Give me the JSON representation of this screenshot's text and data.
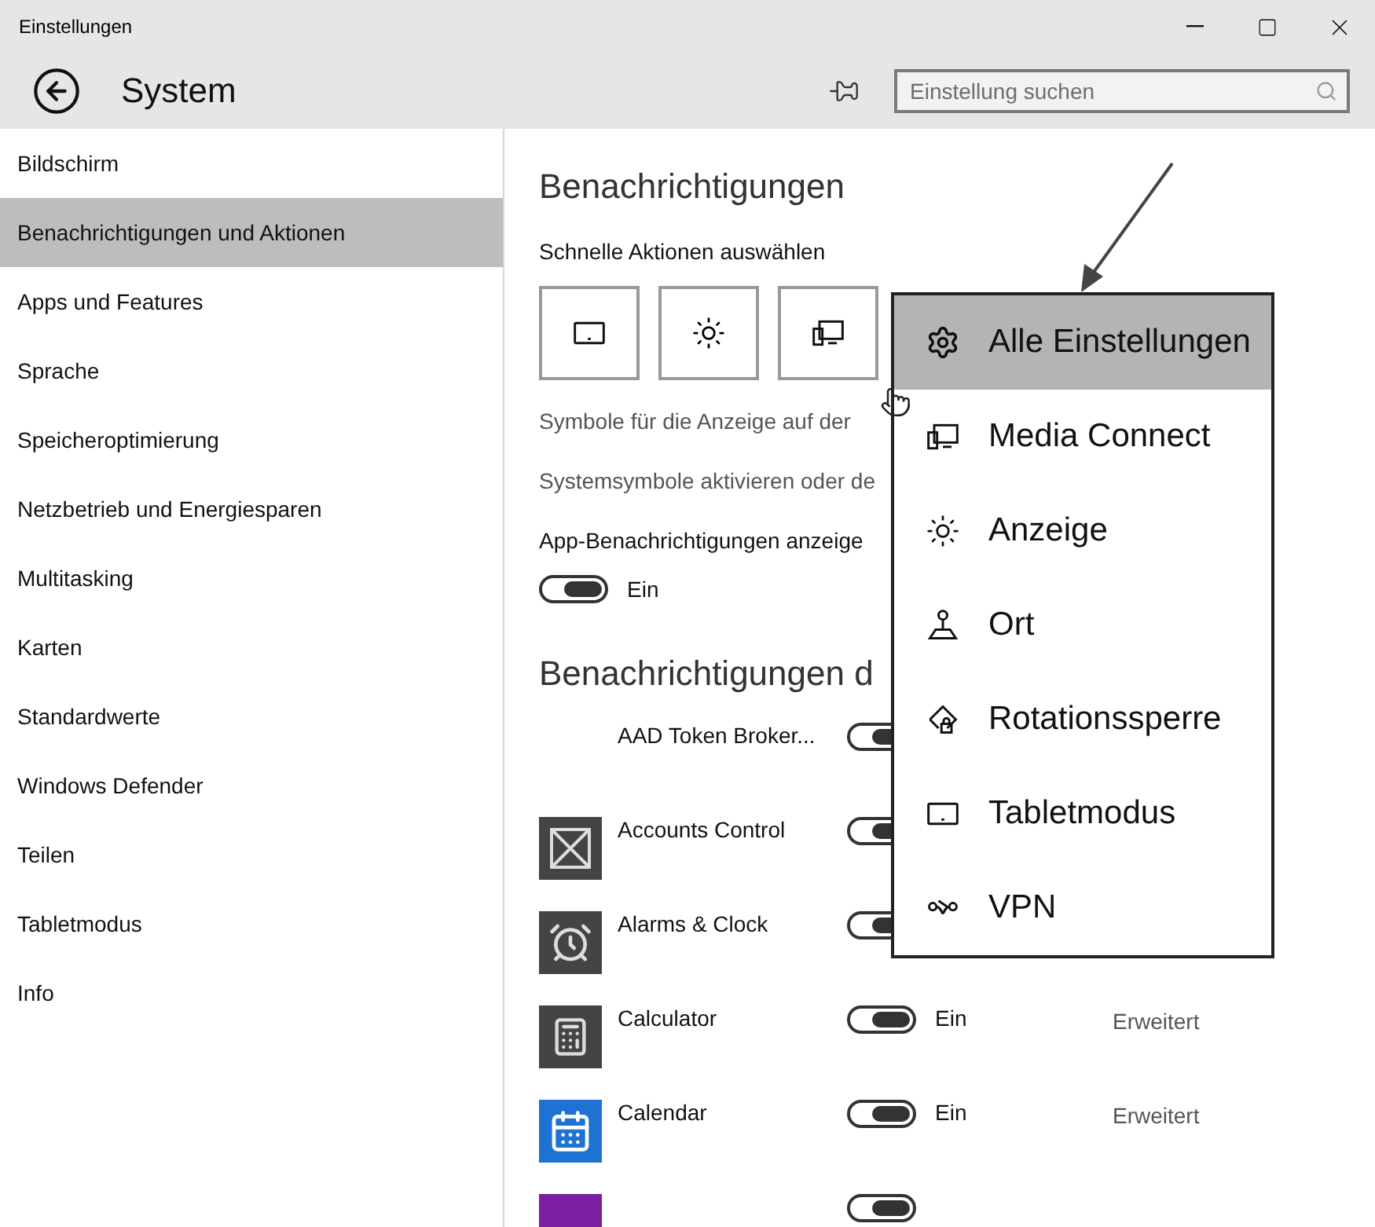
{
  "window": {
    "title": "Einstellungen"
  },
  "header": {
    "title": "System",
    "search": {
      "placeholder": "Einstellung suchen"
    }
  },
  "sidebar": {
    "items": [
      {
        "label": "Bildschirm",
        "selected": false
      },
      {
        "label": "Benachrichtigungen und Aktionen",
        "selected": true
      },
      {
        "label": "Apps und Features",
        "selected": false
      },
      {
        "label": "Sprache",
        "selected": false
      },
      {
        "label": "Speicheroptimierung",
        "selected": false
      },
      {
        "label": "Netzbetrieb und Energiesparen",
        "selected": false
      },
      {
        "label": "Multitasking",
        "selected": false
      },
      {
        "label": "Karten",
        "selected": false
      },
      {
        "label": "Standardwerte",
        "selected": false
      },
      {
        "label": "Windows Defender",
        "selected": false
      },
      {
        "label": "Teilen",
        "selected": false
      },
      {
        "label": "Tabletmodus",
        "selected": false
      },
      {
        "label": "Info",
        "selected": false
      }
    ]
  },
  "content": {
    "heading": "Benachrichtigungen",
    "quick_actions": {
      "label": "Schnelle Aktionen auswählen",
      "tiles": [
        {
          "kind": "tablet"
        },
        {
          "kind": "brightness"
        },
        {
          "kind": "connect"
        }
      ]
    },
    "link_1": "Symbole für die Anzeige auf der",
    "link_2": "Systemsymbole aktivieren oder de",
    "app_notifications": {
      "label": "App-Benachrichtigungen anzeige",
      "on": true,
      "state_label": "Ein"
    },
    "apps_heading": "Benachrichtigungen d",
    "apps": [
      {
        "name": "AAD Token Broker...",
        "on": true
      },
      {
        "name": "Accounts Control",
        "kind": "cross",
        "color": "#444444",
        "on": true
      },
      {
        "name": "Alarms & Clock",
        "kind": "alarm",
        "color": "#444444",
        "on": true
      },
      {
        "name": "Calculator",
        "kind": "calculator",
        "color": "#444444",
        "on": true,
        "state_label": "Ein",
        "link": "Erweitert"
      },
      {
        "name": "Calendar",
        "kind": "calendar",
        "color": "#1e73d2",
        "on": true,
        "state_label": "Ein",
        "link": "Erweitert"
      },
      {
        "color": "#7a1fa2",
        "on": true
      }
    ]
  },
  "quick_menu": {
    "items": [
      {
        "label": "Alle Einstellungen",
        "kind": "settings",
        "selected": true
      },
      {
        "label": "Media Connect",
        "kind": "connect",
        "selected": false
      },
      {
        "label": "Anzeige",
        "kind": "brightness",
        "selected": false
      },
      {
        "label": "Ort",
        "kind": "location",
        "selected": false
      },
      {
        "label": "Rotationssperre",
        "kind": "rotation",
        "selected": false
      },
      {
        "label": "Tabletmodus",
        "kind": "tablet",
        "selected": false
      },
      {
        "label": "VPN",
        "kind": "vpn",
        "selected": false
      }
    ]
  }
}
